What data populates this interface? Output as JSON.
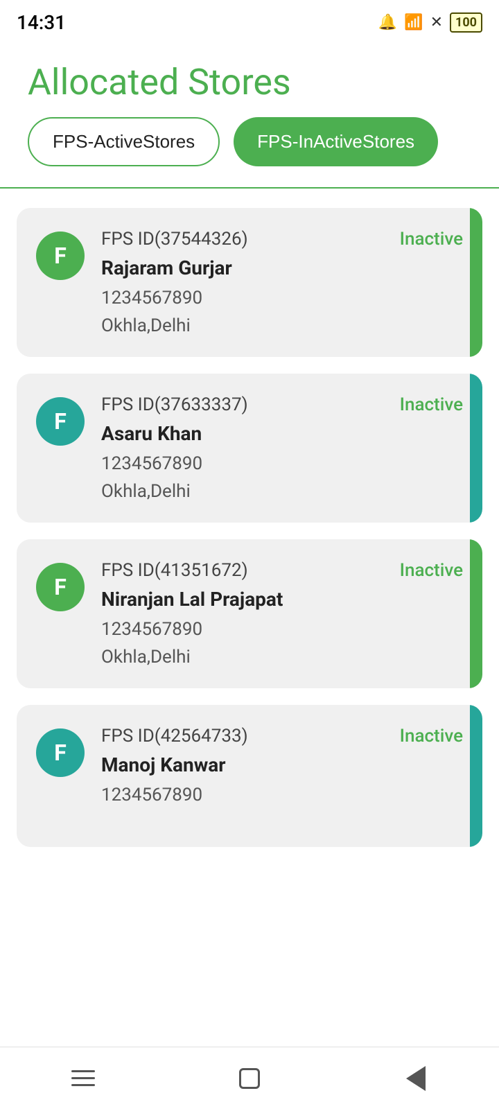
{
  "statusBar": {
    "time": "14:31",
    "battery": "100"
  },
  "page": {
    "title": "Allocated Stores"
  },
  "tabs": [
    {
      "id": "active",
      "label": "FPS-ActiveStores",
      "state": "outline"
    },
    {
      "id": "inactive",
      "label": "FPS-InActiveStores",
      "state": "filled"
    }
  ],
  "stores": [
    {
      "id": "37544326",
      "fps_id_label": "FPS ID",
      "fps_id_value": "(37544326)",
      "name": "Rajaram Gurjar",
      "phone": "1234567890",
      "address": "Okhla,Delhi",
      "status": "Inactive",
      "avatar_letter": "F",
      "avatar_color": "green",
      "bar_color": "green"
    },
    {
      "id": "37633337",
      "fps_id_label": "FPS ID",
      "fps_id_value": "(37633337)",
      "name": "Asaru Khan",
      "phone": "1234567890",
      "address": "Okhla,Delhi",
      "status": "Inactive",
      "avatar_letter": "F",
      "avatar_color": "teal",
      "bar_color": "teal"
    },
    {
      "id": "41351672",
      "fps_id_label": "FPS ID",
      "fps_id_value": "(41351672)",
      "name": "Niranjan Lal Prajapat",
      "phone": "1234567890",
      "address": "Okhla,Delhi",
      "status": "Inactive",
      "avatar_letter": "F",
      "avatar_color": "green",
      "bar_color": "green"
    },
    {
      "id": "42564733",
      "fps_id_label": "FPS ID",
      "fps_id_value": "(42564733)",
      "name": "Manoj Kanwar",
      "phone": "1234567890",
      "address": "",
      "status": "Inactive",
      "avatar_letter": "F",
      "avatar_color": "teal",
      "bar_color": "teal"
    }
  ],
  "nav": {
    "menu_label": "menu",
    "home_label": "home",
    "back_label": "back"
  }
}
